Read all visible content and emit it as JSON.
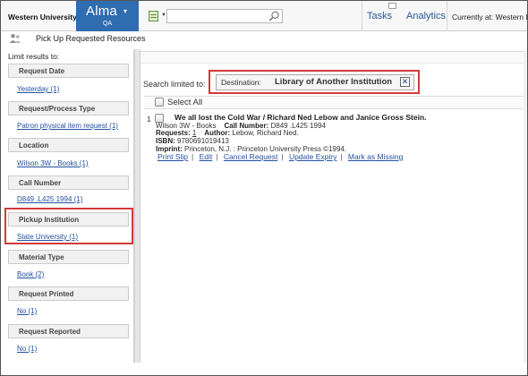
{
  "header": {
    "institution": "Western University",
    "app_name": "Alma",
    "app_caret": "▾",
    "environment": "QA",
    "search_placeholder": "",
    "nav": {
      "tasks": "Tasks",
      "analytics": "Analytics"
    },
    "current_location": "Currently at: Western L",
    "icons": [
      "grid-icon",
      "search-icon",
      "task-bubble-icon"
    ]
  },
  "page": {
    "title": "Pick Up Requested Resources",
    "title_icon": "people-icon"
  },
  "sidebar": {
    "limit_label": "Limit results to:",
    "facets": [
      {
        "header": "Request Date",
        "link": "Yesterday (1)"
      },
      {
        "header": "Request/Process Type",
        "link": "Patron physical item request (1)"
      },
      {
        "header": "Location",
        "link": "Wilson 3W - Books (1)"
      },
      {
        "header": "Call Number",
        "link": "D849 .L425 1994 (1)"
      },
      {
        "header": "Pickup Institution",
        "link": "State University (1)"
      },
      {
        "header": "Material Type",
        "link": "Book (2)"
      },
      {
        "header": "Request Printed",
        "link": "No (1)"
      },
      {
        "header": "Request Reported",
        "link": "No (1)"
      }
    ],
    "highlight_color": "#d33a3a"
  },
  "main": {
    "search_limited_label": "Search limited to:",
    "destination_label": "Destination:",
    "destination_value": "Library of Another Institution",
    "remove_glyph": "✕",
    "select_all_label": "Select All",
    "results": [
      {
        "index": "1",
        "title": "We all lost the Cold War / Richard Ned Lebow and Janice Gross Stein.",
        "location": "Wilson 3W - Books",
        "call_number_label": "Call Number:",
        "call_number": "D849 .L425 1994",
        "requests_label": "Requests:",
        "requests": "1",
        "author_label": "Author:",
        "author": "Lebow, Richard Ned.",
        "isbn_label": "ISBN:",
        "isbn": "9780691019413",
        "imprint_label": "Imprint:",
        "imprint": "Princeton, N.J. : Princeton University Press ©1994.",
        "actions": [
          "Print Slip",
          "Edit",
          "Cancel Request",
          "Update Expiry",
          "Mark as Missing"
        ]
      }
    ]
  },
  "colors": {
    "brand": "#2f6cb0",
    "link": "#2350a0",
    "highlight": "#d33a3a"
  }
}
